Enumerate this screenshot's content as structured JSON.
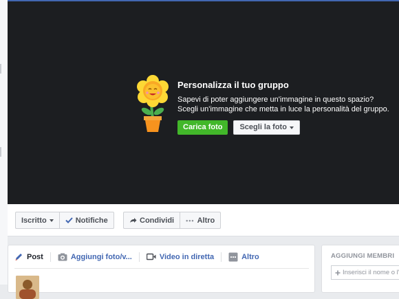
{
  "cover": {
    "title": "Personalizza il tuo gruppo",
    "description_line1": "Sapevi di poter aggiungere un'immagine in questo spazio?",
    "description_line2": "Scegli un'immagine che metta in luce la personalità del gruppo.",
    "upload_label": "Carica foto",
    "choose_label": "Scegli la foto",
    "icon": "sunflower-pot-illustration"
  },
  "actions": {
    "joined_label": "Iscritto",
    "notifications_label": "Notifiche",
    "share_label": "Condividi",
    "more_label": "Altro"
  },
  "composer": {
    "tabs": [
      {
        "label": "Post",
        "icon": "pencil-icon"
      },
      {
        "label": "Aggiungi foto/v...",
        "icon": "camera-icon"
      },
      {
        "label": "Video in diretta",
        "icon": "video-camera-icon"
      },
      {
        "label": "Altro",
        "icon": "more-icon"
      }
    ]
  },
  "members": {
    "title": "AGGIUNGI MEMBRI",
    "input_placeholder": "Inserisci il nome o l'"
  },
  "colors": {
    "cover_bg": "#1c1e21",
    "primary_green": "#42b72a",
    "link_blue": "#4267b2",
    "page_bg": "#e9ebee"
  }
}
